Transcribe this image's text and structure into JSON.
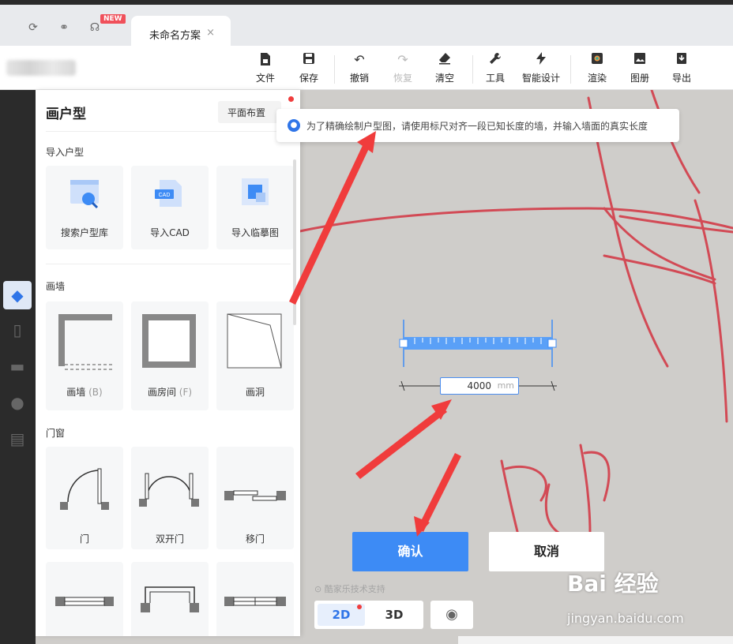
{
  "tabs": {
    "new_badge": "NEW",
    "doc_title": "未命名方案",
    "close": "×"
  },
  "toolbar": {
    "file": "文件",
    "save": "保存",
    "undo": "撤销",
    "redo": "恢复",
    "clear": "清空",
    "tools": "工具",
    "smart_design": "智能设计",
    "render": "渲染",
    "album": "图册",
    "export": "导出"
  },
  "panel": {
    "title": "画户型",
    "layout_button": "平面布置",
    "sections": {
      "import": "导入户型",
      "walls": "画墙",
      "doors_windows": "门窗"
    },
    "import_items": [
      {
        "label": "搜索户型库",
        "icon": "search-floorplan-icon"
      },
      {
        "label": "导入CAD",
        "icon": "cad-file-icon",
        "badge": "CAD"
      },
      {
        "label": "导入临摹图",
        "icon": "trace-image-icon"
      }
    ],
    "wall_items": [
      {
        "label": "画墙",
        "hint": "(B)"
      },
      {
        "label": "画房间",
        "hint": "(F)"
      },
      {
        "label": "画洞",
        "hint": ""
      }
    ],
    "door_items": [
      {
        "label": "门"
      },
      {
        "label": "双开门"
      },
      {
        "label": "移门"
      }
    ]
  },
  "hint": {
    "text": "为了精确绘制户型图，请使用标尺对齐一段已知长度的墙，并输入墙面的真实长度"
  },
  "ruler": {
    "length_value": "4000",
    "unit": "mm"
  },
  "dialog": {
    "confirm": "确认",
    "cancel": "取消"
  },
  "support_text": "酷家乐技术支持",
  "view": {
    "mode_2d": "2D",
    "mode_3d": "3D"
  },
  "watermark": {
    "brand": "Bai 经验",
    "url": "jingyan.baidu.com"
  },
  "colors": {
    "accent": "#3d8bf5",
    "arrow": "#f03c3c",
    "sketch_lines": "#d24a55"
  }
}
